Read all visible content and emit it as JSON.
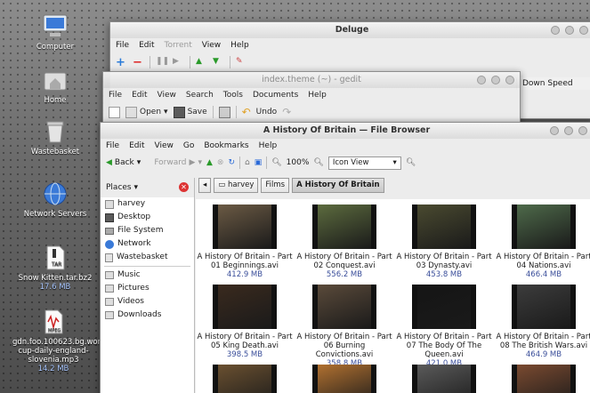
{
  "desktop": {
    "icons": [
      {
        "label": "Computer",
        "sub": ""
      },
      {
        "label": "Home",
        "sub": ""
      },
      {
        "label": "Wastebasket",
        "sub": ""
      },
      {
        "label": "Network Servers",
        "sub": ""
      },
      {
        "label": "Snow Kitten.tar.bz2",
        "sub": "17.6 MB"
      },
      {
        "label": "gdn.foo.100623.bg.world-cup-daily-england-slovenia.mp3",
        "sub": "14.2 MB"
      }
    ]
  },
  "deluge": {
    "title": "Deluge",
    "menu": [
      "File",
      "Edit",
      "Torrent",
      "View",
      "Help"
    ],
    "column_down_speed": "Down Speed"
  },
  "gedit": {
    "title": "index.theme (~) - gedit",
    "menu": [
      "File",
      "Edit",
      "View",
      "Search",
      "Tools",
      "Documents",
      "Help"
    ],
    "toolbar": {
      "open": "Open",
      "save": "Save",
      "undo": "Undo"
    }
  },
  "filebrowser": {
    "title": "A History Of Britain — File Browser",
    "menu": [
      "File",
      "Edit",
      "View",
      "Go",
      "Bookmarks",
      "Help"
    ],
    "nav": {
      "back": "Back",
      "forward": "Forward",
      "zoom": "100%",
      "view_mode": "Icon View"
    },
    "sidebar": {
      "header": "Places",
      "places": [
        "harvey",
        "Desktop",
        "File System",
        "Network",
        "Wastebasket"
      ],
      "bookmarks": [
        "Music",
        "Pictures",
        "Videos",
        "Downloads"
      ]
    },
    "pathbar": [
      "harvey",
      "Films",
      "A History Of Britain"
    ],
    "files": [
      {
        "name": "A History Of Britain - Part 01 Beginnings.avi",
        "size": "412.9 MB",
        "color": "#6b5a44"
      },
      {
        "name": "A History Of Britain - Part 02 Conquest.avi",
        "size": "556.2 MB",
        "color": "#5c6b3e"
      },
      {
        "name": "A History Of Britain - Part 03 Dynasty.avi",
        "size": "453.8 MB",
        "color": "#4a4a30"
      },
      {
        "name": "A History Of Britain - Part 04 Nations.avi",
        "size": "466.4 MB",
        "color": "#4e6a4a"
      },
      {
        "name": "A History Of Britain - Part 05 King Death.avi",
        "size": "398.5 MB",
        "color": "#3a2a1e"
      },
      {
        "name": "A History Of Britain - Part 06 Burning Convictions.avi",
        "size": "358.8 MB",
        "color": "#5a4a3a"
      },
      {
        "name": "A History Of Britain - Part 07 The Body Of The Queen.avi",
        "size": "421.0 MB",
        "color": "#151515"
      },
      {
        "name": "A History Of Britain - Part 08 The British Wars.avi",
        "size": "464.9 MB",
        "color": "#3c3c3c"
      },
      {
        "name": "",
        "size": "",
        "color": "#6a5030"
      },
      {
        "name": "",
        "size": "",
        "color": "#b07030"
      },
      {
        "name": "",
        "size": "",
        "color": "#5a5a5a"
      },
      {
        "name": "",
        "size": "",
        "color": "#7a4a30"
      }
    ]
  }
}
